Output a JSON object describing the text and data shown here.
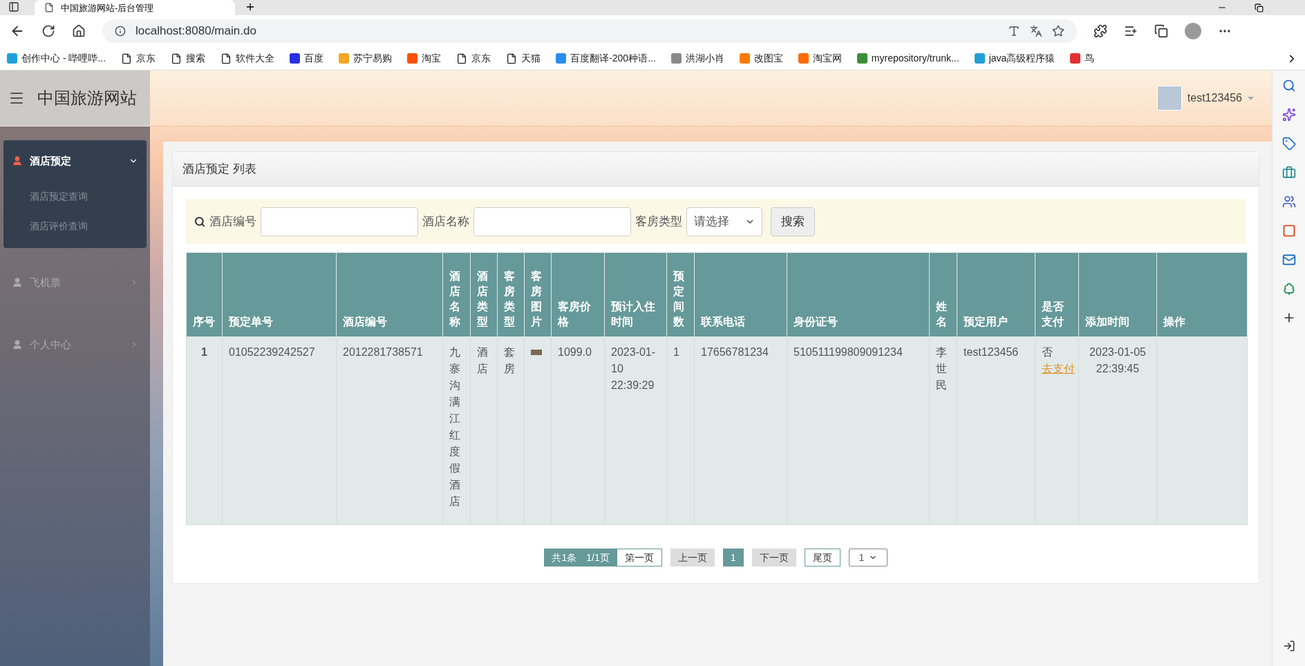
{
  "browser": {
    "tab_title": "中国旅游网站-后台管理",
    "address": "localhost:8080/main.do",
    "bookmarks": [
      {
        "label": "创作中心 - 哔哩哔...",
        "kind": "site",
        "color": "#20a0d8"
      },
      {
        "label": "京东",
        "kind": "page"
      },
      {
        "label": "搜索",
        "kind": "page"
      },
      {
        "label": "软件大全",
        "kind": "page"
      },
      {
        "label": "百度",
        "kind": "site",
        "color": "#2932e1"
      },
      {
        "label": "苏宁易购",
        "kind": "site",
        "color": "#f5a623"
      },
      {
        "label": "淘宝",
        "kind": "site",
        "color": "#ff5000"
      },
      {
        "label": "京东",
        "kind": "page"
      },
      {
        "label": "天猫",
        "kind": "page"
      },
      {
        "label": "百度翻译-200种语...",
        "kind": "site",
        "color": "#2d8cf0"
      },
      {
        "label": "洪湖小肖",
        "kind": "site",
        "color": "#8a8a8a"
      },
      {
        "label": "改图宝",
        "kind": "site",
        "color": "#ff7a00"
      },
      {
        "label": "淘宝网",
        "kind": "site",
        "color": "#ff6a00"
      },
      {
        "label": "myrepository/trunk...",
        "kind": "site",
        "color": "#3b8f3b"
      },
      {
        "label": "java高级程序猿",
        "kind": "site",
        "color": "#20a0d8"
      },
      {
        "label": "鸟",
        "kind": "site",
        "color": "#e03030"
      }
    ]
  },
  "app": {
    "site_title": "中国旅游网站",
    "user": "test123456",
    "menu": [
      {
        "label": "酒店预定",
        "expanded": true,
        "children": [
          {
            "label": "酒店预定查询"
          },
          {
            "label": "酒店评价查询"
          }
        ]
      },
      {
        "label": "飞机票",
        "expanded": false
      },
      {
        "label": "个人中心",
        "expanded": false
      }
    ],
    "panel_title": "酒店预定 列表",
    "search": {
      "fields": [
        {
          "label": "酒店编号",
          "kind": "input"
        },
        {
          "label": "酒店名称",
          "kind": "input"
        },
        {
          "label": "客房类型",
          "kind": "select",
          "value": "请选择"
        }
      ],
      "button": "搜索"
    },
    "table": {
      "columns": [
        "序号",
        "预定单号",
        "酒店编号",
        "酒店名称",
        "酒店类型",
        "客房类型",
        "客房图片",
        "客房价格",
        "预计入住时间",
        "预定间数",
        "联系电话",
        "身份证号",
        "姓名",
        "预定用户",
        "是否支付",
        "添加时间",
        "操作"
      ],
      "rows": [
        {
          "cells": [
            {
              "kind": "index",
              "text": "1"
            },
            {
              "kind": "text",
              "text": "01052239242527"
            },
            {
              "kind": "text",
              "text": "2012281738571"
            },
            {
              "kind": "text",
              "text": "九寨沟满江红度假酒店"
            },
            {
              "kind": "text",
              "text": "酒店"
            },
            {
              "kind": "text",
              "text": "套房"
            },
            {
              "kind": "image"
            },
            {
              "kind": "text",
              "text": "1099.0"
            },
            {
              "kind": "text",
              "text": "2023-01-10 22:39:29"
            },
            {
              "kind": "text",
              "text": "1"
            },
            {
              "kind": "text",
              "text": "17656781234"
            },
            {
              "kind": "text",
              "text": "510511199809091234"
            },
            {
              "kind": "text",
              "text": "李世民"
            },
            {
              "kind": "text",
              "text": "test123456"
            },
            {
              "kind": "pay",
              "text": "否",
              "link": "去支付"
            },
            {
              "kind": "center",
              "text": "2023-01-05 22:39:45"
            },
            {
              "kind": "text",
              "text": ""
            }
          ]
        }
      ]
    },
    "pagination": {
      "summary": [
        "共1条",
        "1/1页"
      ],
      "buttons": [
        {
          "label": "第一页",
          "kind": "enabled"
        },
        {
          "label": "上一页",
          "kind": "disabled"
        },
        {
          "label": "1",
          "kind": "page",
          "selected": true
        },
        {
          "label": "下一页",
          "kind": "disabled"
        },
        {
          "label": "尾页",
          "kind": "enabled"
        }
      ],
      "select": "1"
    }
  }
}
